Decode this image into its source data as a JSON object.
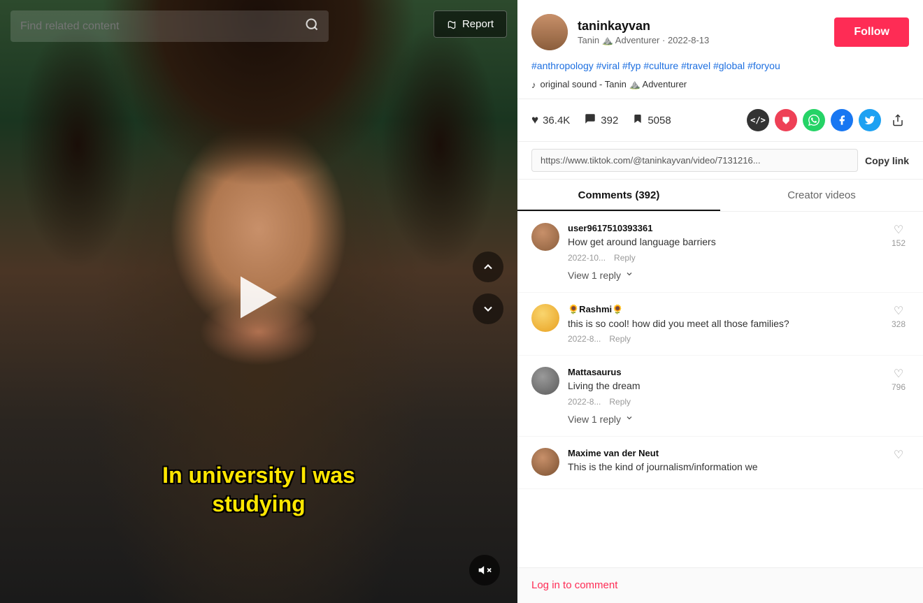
{
  "video": {
    "search_placeholder": "Find related content",
    "report_label": "Report",
    "subtitle_line1": "In university I was",
    "subtitle_line2": "studying",
    "play_icon": "▶",
    "mute_icon": "🔇",
    "nav_up_icon": "∧",
    "nav_down_icon": "∨"
  },
  "profile": {
    "username": "taninkayvan",
    "display_name": "Tanin",
    "emoji": "⛰️",
    "role": "Adventurer",
    "date": "2022-8-13",
    "follow_label": "Follow",
    "hashtags": "#anthropology #viral #fyp #culture #travel #global #foryou",
    "sound_icon": "♪",
    "sound_text": "original sound - Tanin ⛰️ Adventurer"
  },
  "stats": {
    "likes": "36.4K",
    "comments": "392",
    "bookmarks": "5058",
    "like_icon": "♥",
    "comment_icon": "💬",
    "bookmark_icon": "🔖"
  },
  "share": {
    "url": "https://www.tiktok.com/@taninkayvan/video/7131216...",
    "copy_label": "Copy link"
  },
  "tabs": [
    {
      "id": "comments",
      "label": "Comments (392)",
      "active": true
    },
    {
      "id": "creator",
      "label": "Creator videos",
      "active": false
    }
  ],
  "comments": [
    {
      "id": 1,
      "username": "user9617510393361",
      "text": "How get around language barriers",
      "date": "2022-10...",
      "reply_label": "Reply",
      "likes": "152",
      "view_reply": "View 1 reply",
      "has_reply": true
    },
    {
      "id": 2,
      "username": "🌻Rashmi🌻",
      "text": "this is so cool! how did you meet all those families?",
      "date": "2022-8...",
      "reply_label": "Reply",
      "likes": "328",
      "has_reply": false
    },
    {
      "id": 3,
      "username": "Mattasaurus",
      "text": "Living the dream",
      "date": "2022-8...",
      "reply_label": "Reply",
      "likes": "796",
      "view_reply": "View 1 reply",
      "has_reply": true
    },
    {
      "id": 4,
      "username": "Maxime van der Neut",
      "text": "This is the kind of journalism/information we",
      "date": "",
      "reply_label": "",
      "likes": "",
      "has_reply": false
    }
  ],
  "footer": {
    "login_label": "Log in to comment"
  }
}
